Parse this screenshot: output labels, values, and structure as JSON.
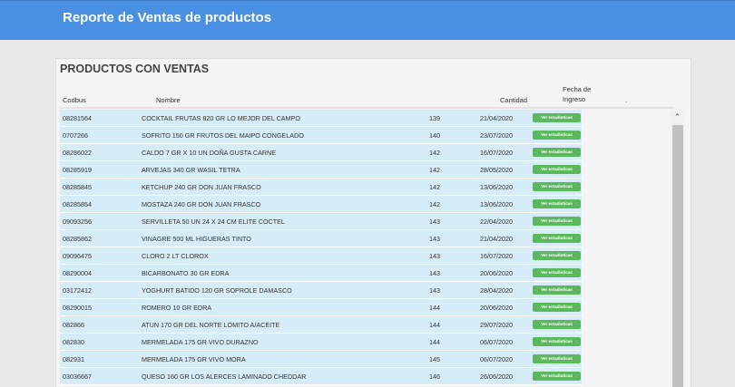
{
  "header": {
    "title": "Reporte de Ventas de productos"
  },
  "panel": {
    "title": "PRODUCTOS CON VENTAS",
    "columns": {
      "codbus": "Codbus",
      "nombre": "Nombre",
      "cantidad": "Cantidad",
      "fecha_line1": "Fecha de",
      "fecha_line2": "Ingreso",
      "extra": "."
    },
    "button_label": "Ver estadisticas",
    "rows": [
      {
        "code": "08281564",
        "name": "COCKTAIL FRUTAS 820 GR LO MEJOR DEL CAMPO",
        "qty": "139",
        "date": "21/04/2020"
      },
      {
        "code": "0707266",
        "name": "SOFRITO 150 GR FRUTOS DEL MAIPO CONGELADO",
        "qty": "140",
        "date": "23/07/2020"
      },
      {
        "code": "08286022",
        "name": "CALDO 7 GR X 10 UN DOÑA GUSTA CARNE",
        "qty": "142",
        "date": "16/07/2020"
      },
      {
        "code": "08285919",
        "name": "ARVEJAS 340 GR WASIL TETRA",
        "qty": "142",
        "date": "28/05/2020"
      },
      {
        "code": "08285845",
        "name": "KETCHUP 240 GR DON JUAN FRASCO",
        "qty": "142",
        "date": "13/06/2020"
      },
      {
        "code": "08285854",
        "name": "MOSTAZA 240 GR DON JUAN FRASCO",
        "qty": "142",
        "date": "13/06/2020"
      },
      {
        "code": "09093256",
        "name": "SERVILLETA 50 UN 24 X 24 CM ELITE COCTEL",
        "qty": "143",
        "date": "22/04/2020"
      },
      {
        "code": "08285862",
        "name": "VINAGRE 500 ML HIGUERAS TINTO",
        "qty": "143",
        "date": "21/04/2020"
      },
      {
        "code": "09096475",
        "name": "CLORO 2 LT CLOROX",
        "qty": "143",
        "date": "16/07/2020"
      },
      {
        "code": "08290004",
        "name": "BICARBONATO 30 GR EDRA",
        "qty": "143",
        "date": "20/06/2020"
      },
      {
        "code": "03172412",
        "name": "YOGHURT BATIDO 120 GR SOPROLE DAMASCO",
        "qty": "143",
        "date": "28/04/2020"
      },
      {
        "code": "08290015",
        "name": "ROMERO 10 GR EDRA",
        "qty": "144",
        "date": "20/06/2020"
      },
      {
        "code": "082866",
        "name": "ATUN 170 GR DEL NORTE LOMITO A/ACEITE",
        "qty": "144",
        "date": "29/07/2020"
      },
      {
        "code": "082830",
        "name": "MERMELADA 175 GR VIVO DURAZNO",
        "qty": "144",
        "date": "06/07/2020"
      },
      {
        "code": "082931",
        "name": "MERMELADA 175 GR VIVO MORA",
        "qty": "145",
        "date": "06/07/2020"
      },
      {
        "code": "03036667",
        "name": "QUESO 160 GR LOS ALERCES LAMINADO CHEDDAR",
        "qty": "146",
        "date": "26/06/2020"
      }
    ]
  },
  "colors": {
    "header_bg": "#4a90e2",
    "row_bg": "#d6ecf6",
    "button_bg": "#5cb85c"
  }
}
